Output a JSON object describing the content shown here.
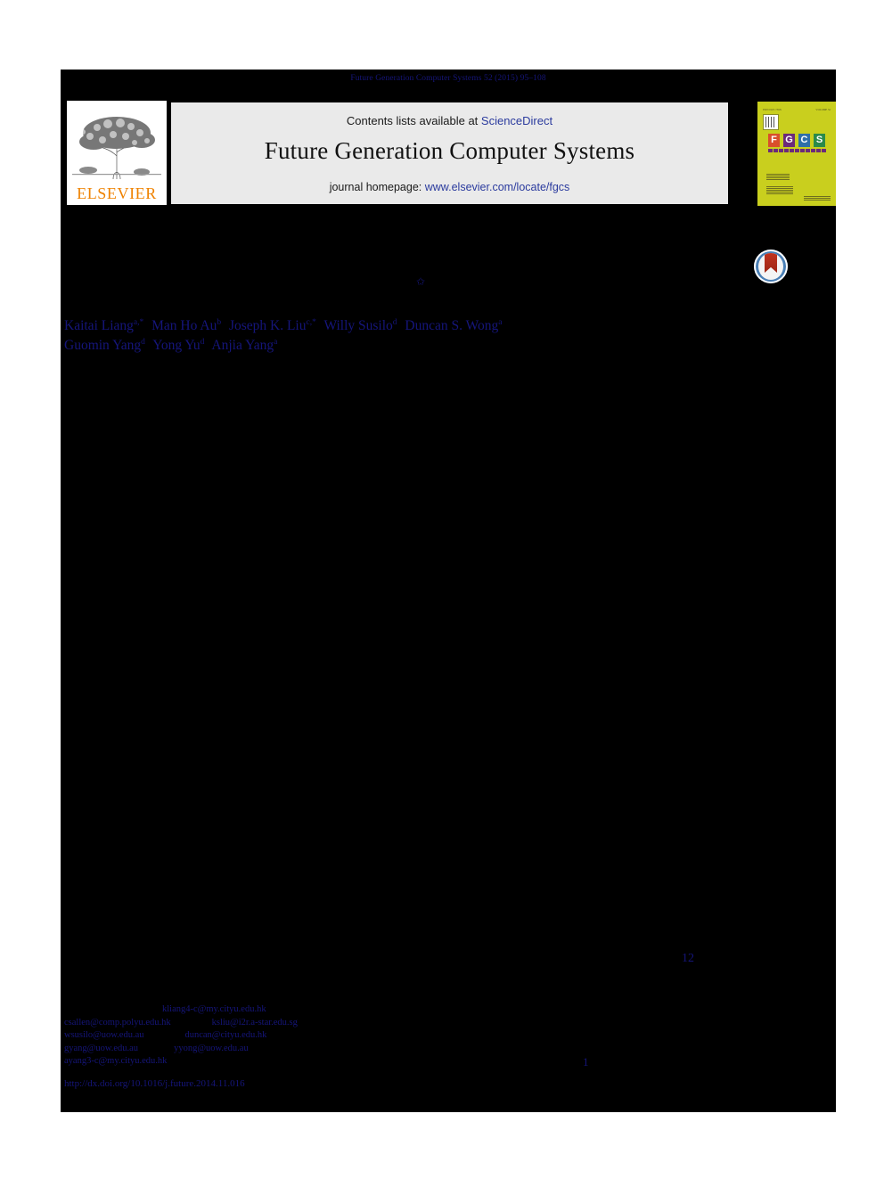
{
  "document": {
    "type": "journal-article-first-page",
    "running_head": "Future Generation Computer Systems 52 (2015) 95–108"
  },
  "masthead": {
    "publisher_logo_label": "ELSEVIER",
    "contents_prefix": "Contents lists available at ",
    "contents_link": "ScienceDirect",
    "journal_title": "Future Generation Computer Systems",
    "homepage_prefix": "journal homepage: ",
    "homepage_link": "www.elsevier.com/locate/fgcs",
    "cover": {
      "top_left_text": "ISSN 0167-739X",
      "top_right_text": "VOLUME 52",
      "letters": [
        "F",
        "G",
        "C",
        "S"
      ],
      "letter_colors": [
        "#d94f2b",
        "#6b2a7a",
        "#2f6fa8",
        "#2a8a4a"
      ],
      "subtitle": "FUTURE GENERATION COMPUTER SYSTEMS"
    },
    "crossmark_label": "CrossMark"
  },
  "article": {
    "title": "",
    "title_footnote_marker": "✩",
    "authors_line_1": [
      {
        "name": "Kaitai Liang",
        "marks": "a,*"
      },
      {
        "name": "Man Ho Au",
        "marks": "b"
      },
      {
        "name": "Joseph K. Liu",
        "marks": "c,*"
      },
      {
        "name": "Willy Susilo",
        "marks": "d"
      },
      {
        "name": "Duncan S. Wong",
        "marks": "a"
      }
    ],
    "authors_line_2": [
      {
        "name": "Guomin Yang",
        "marks": "d"
      },
      {
        "name": "Yong Yu",
        "marks": "d"
      },
      {
        "name": "Anjia Yang",
        "marks": "a"
      }
    ],
    "body_citation": "12",
    "footnote_number": "1"
  },
  "footnotes": {
    "email_rows": [
      {
        "indent": true,
        "items": [
          "kliang4-c@my.cityu.edu.hk"
        ]
      },
      {
        "indent": false,
        "items": [
          "csallen@comp.polyu.edu.hk",
          "ksliu@i2r.a-star.edu.sg"
        ]
      },
      {
        "indent": false,
        "items": [
          "wsusilo@uow.edu.au",
          "duncan@cityu.edu.hk"
        ]
      },
      {
        "indent": false,
        "items": [
          "gyang@uow.edu.au",
          "yyong@uow.edu.au"
        ]
      },
      {
        "indent": false,
        "items": [
          "ayang3-c@my.cityu.edu.hk"
        ]
      }
    ],
    "doi_url": "http://dx.doi.org/10.1016/j.future.2014.11.016"
  },
  "colors": {
    "link_blue": "#15157a",
    "masthead_blue": "#2b3b9e",
    "elsevier_orange": "#ef8200",
    "band_grey": "#eaeaea",
    "cover_yellow": "#c9cf1e",
    "crossmark_blue": "#4a7fb5",
    "crossmark_red": "#c0341f",
    "page_black": "#000000"
  }
}
